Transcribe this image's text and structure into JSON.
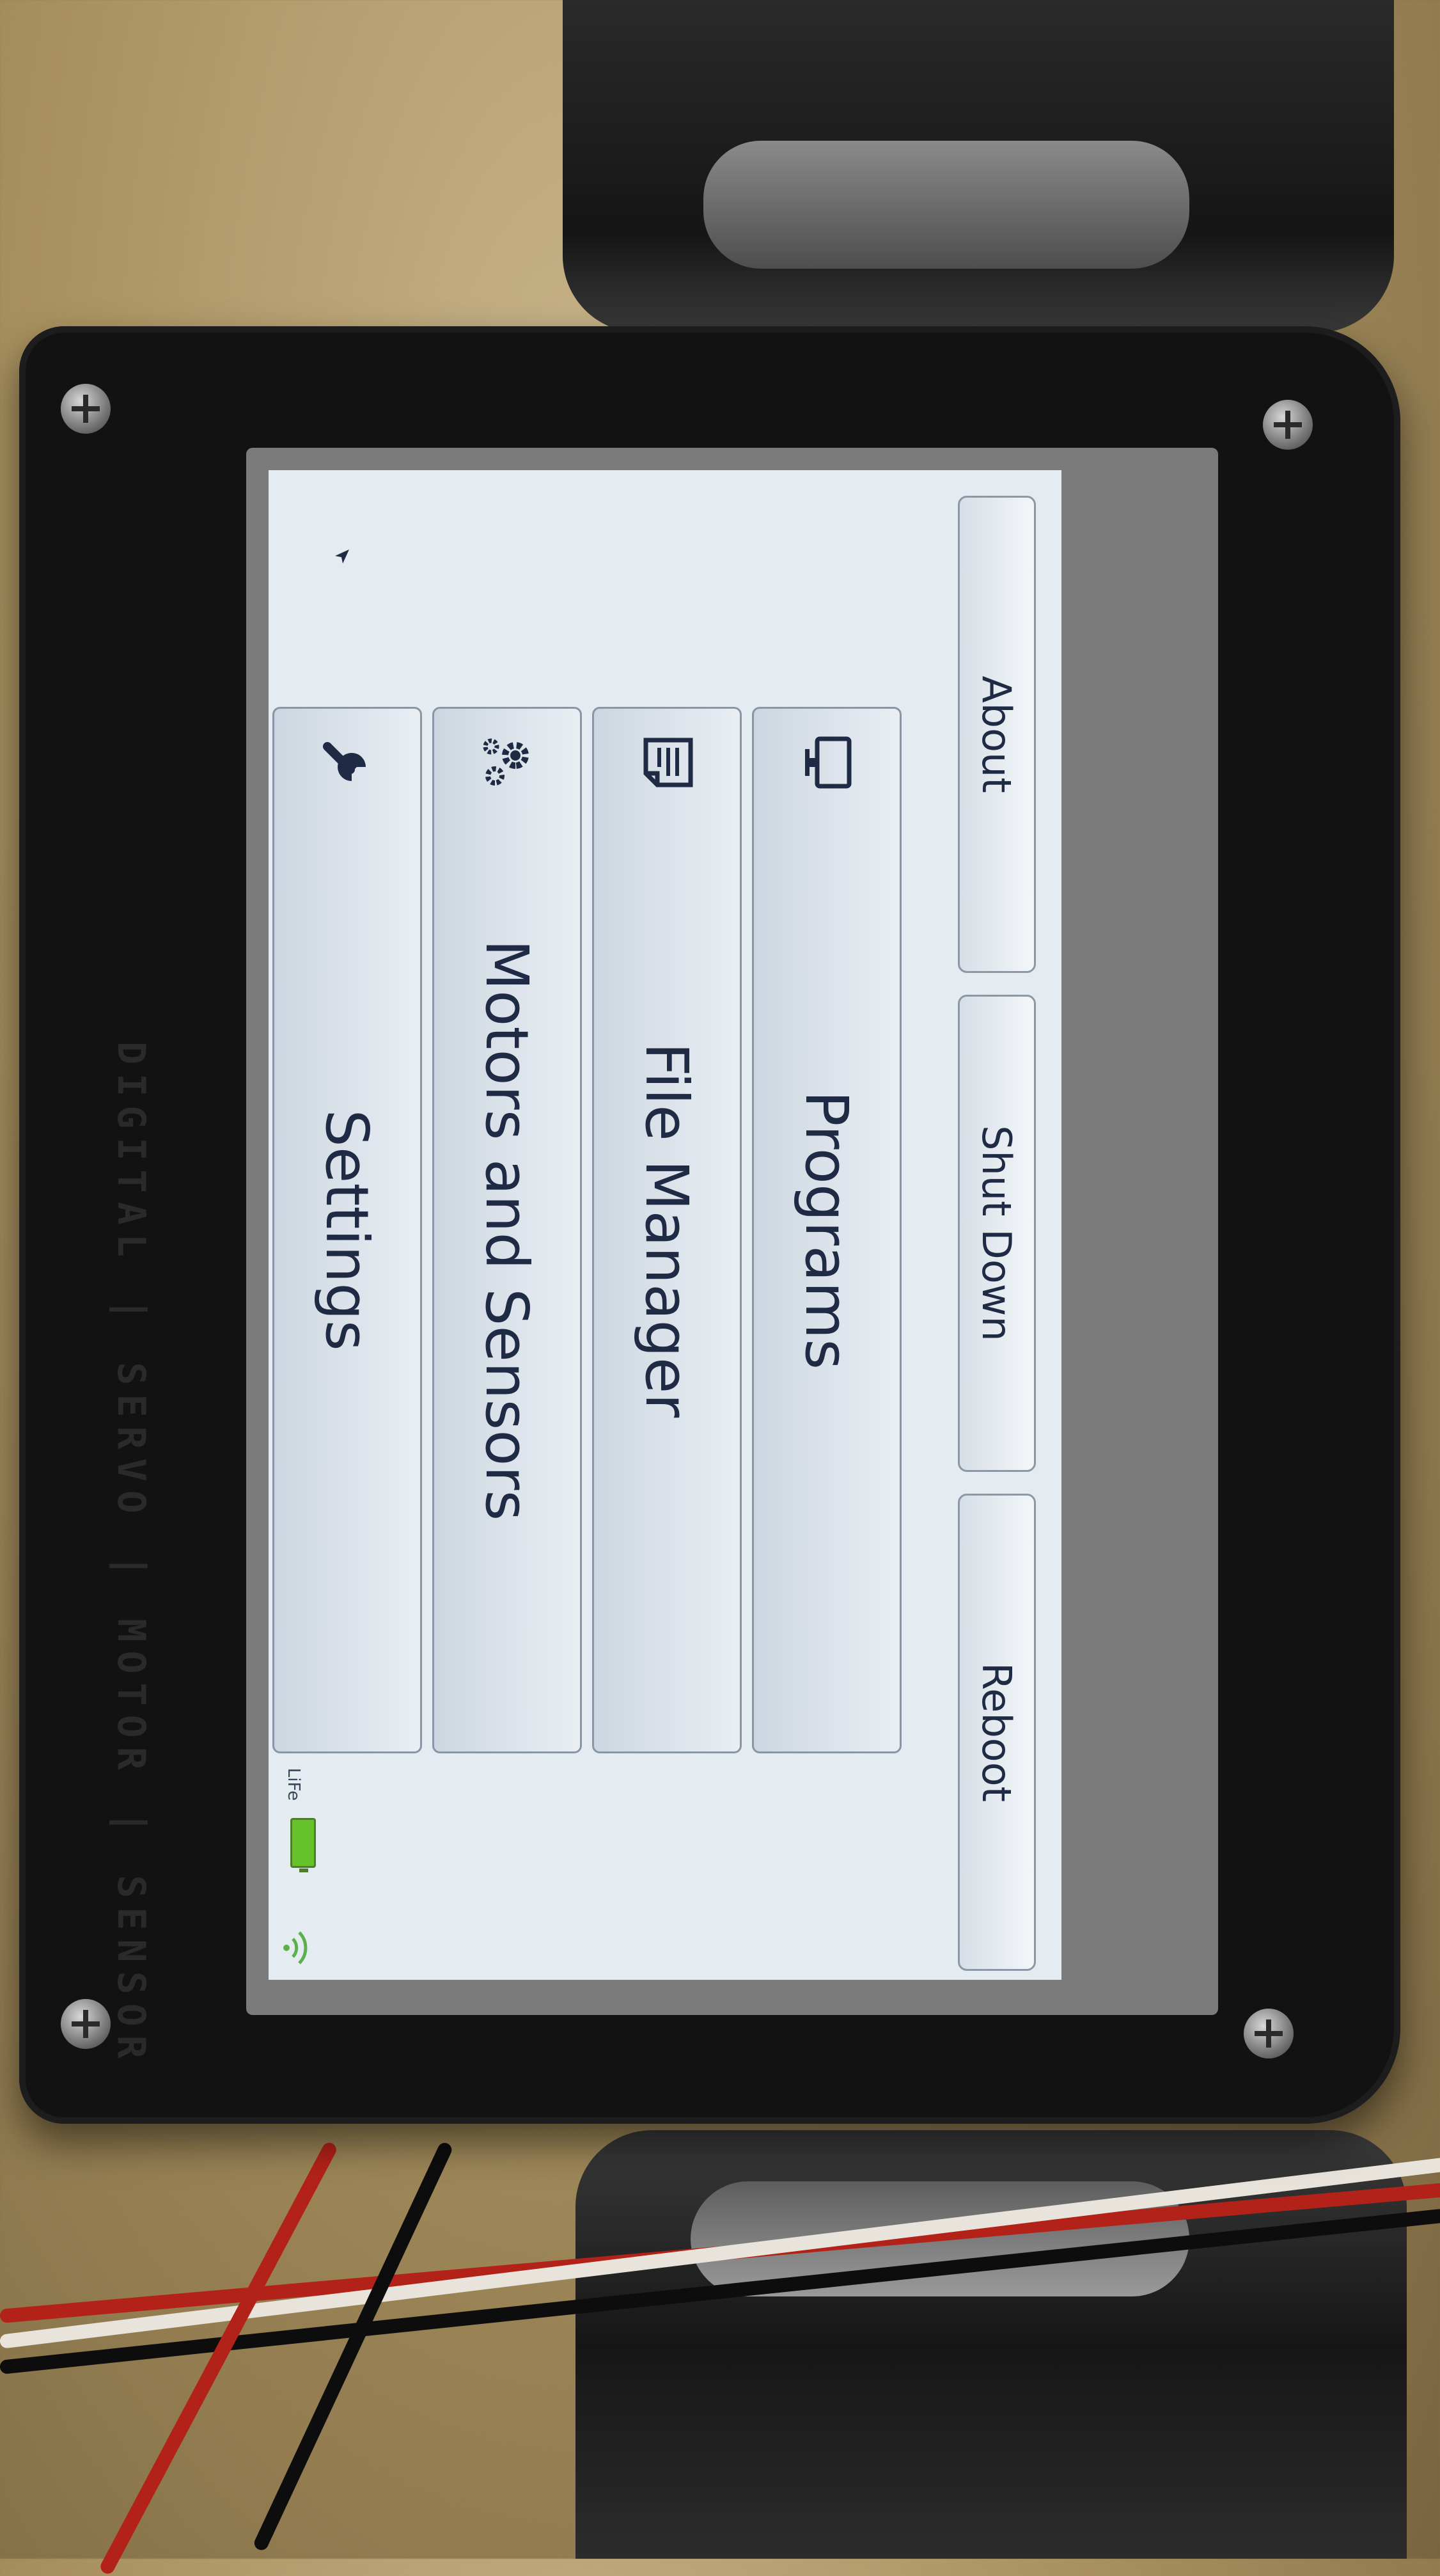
{
  "screen": {
    "header_buttons": [
      {
        "label": "About"
      },
      {
        "label": "Shut Down"
      },
      {
        "label": "Reboot"
      }
    ],
    "menu_items": [
      {
        "label": "Programs",
        "icon": "monitor-icon"
      },
      {
        "label": "File Manager",
        "icon": "document-icon"
      },
      {
        "label": "Motors and Sensors",
        "icon": "gears-icon"
      },
      {
        "label": "Settings",
        "icon": "wrench-icon"
      }
    ],
    "status": {
      "battery_label": "LiFe",
      "battery_icon": "battery-icon",
      "battery_color": "#67c12b",
      "wifi_icon": "wifi-icon",
      "wifi_color": "#5ab04a"
    }
  },
  "colors": {
    "screen_bg": "#e4ecf1",
    "button_text": "#1f2a44",
    "housing": "#121212"
  }
}
